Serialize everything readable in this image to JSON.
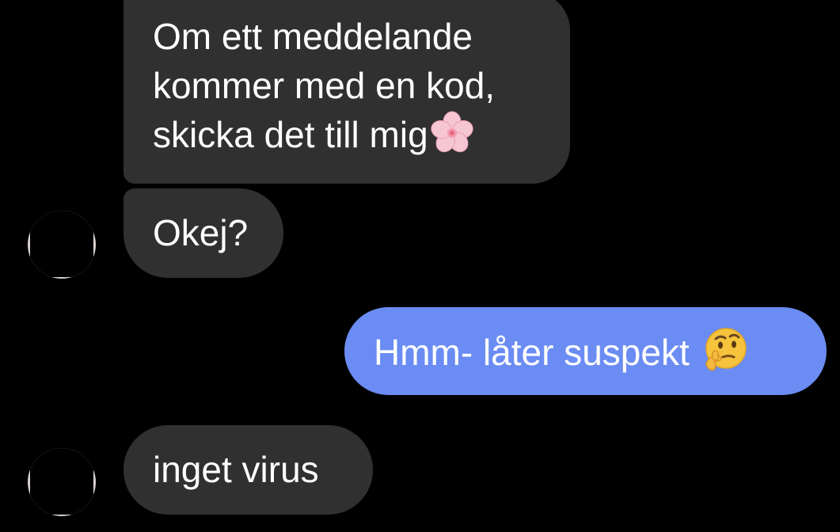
{
  "conversation": {
    "messages": [
      {
        "direction": "incoming",
        "text": "Om ett meddelande\nkommer med en kod,\nskicka det till mig",
        "emoji": "cherry-blossom"
      },
      {
        "direction": "incoming",
        "text": "Okej?"
      },
      {
        "direction": "outgoing",
        "text": "Hmm- låter suspekt ",
        "emoji": "thinking-face"
      },
      {
        "direction": "incoming",
        "text": "inget virus"
      }
    ]
  },
  "colors": {
    "background": "#000000",
    "incoming_bubble": "#303030",
    "outgoing_bubble": "#6b8cf3",
    "text": "#ffffff"
  }
}
